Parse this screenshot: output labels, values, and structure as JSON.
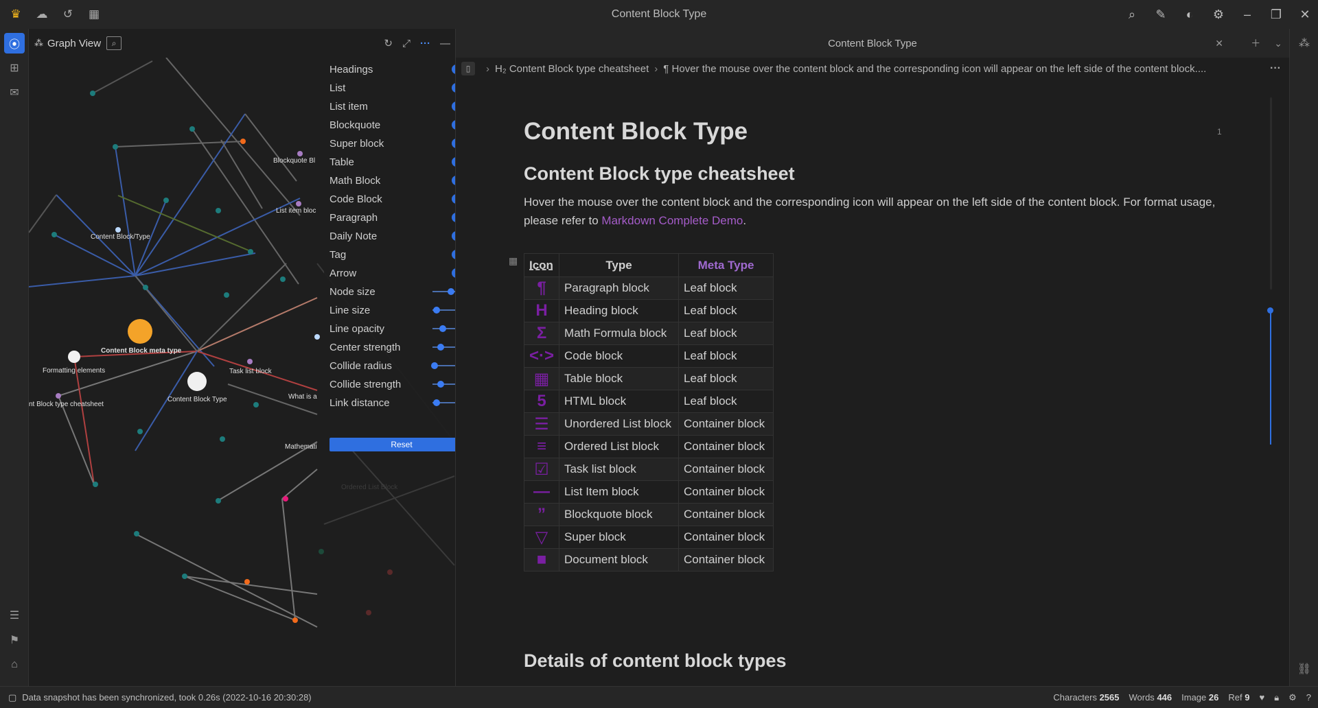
{
  "titlebar": {
    "title": "Content Block Type"
  },
  "graph": {
    "title": "Graph View",
    "toggles": [
      {
        "label": "Headings"
      },
      {
        "label": "List"
      },
      {
        "label": "List item"
      },
      {
        "label": "Blockquote"
      },
      {
        "label": "Super block"
      },
      {
        "label": "Table"
      },
      {
        "label": "Math Block"
      },
      {
        "label": "Code Block"
      },
      {
        "label": "Paragraph"
      },
      {
        "label": "Daily Note"
      },
      {
        "label": "Tag"
      },
      {
        "label": "Arrow"
      }
    ],
    "sliders": [
      {
        "label": "Node size",
        "value": 0.45
      },
      {
        "label": "Line size",
        "value": 0.1
      },
      {
        "label": "Line opacity",
        "value": 0.25
      },
      {
        "label": "Center strength",
        "value": 0.2
      },
      {
        "label": "Collide radius",
        "value": 0.05
      },
      {
        "label": "Collide strength",
        "value": 0.2
      },
      {
        "label": "Link distance",
        "value": 0.1
      }
    ],
    "reset_label": "Reset",
    "node_labels": {
      "blockquote": "Blockquote Bl",
      "list_item": "List item bloc",
      "content_block_type_path": "Content Block/Type",
      "meta_type": "Content Block meta type",
      "formatting": "Formatting elements",
      "cheatsheet": "nt Block type cheatsheet",
      "content_block_type": "Content Block Type",
      "task_list": "Task list block",
      "what_is": "What is a",
      "math": "Mathemati",
      "ordered": "Ordered List Block"
    }
  },
  "editor": {
    "tab_title": "Content Block Type",
    "breadcrumb": {
      "heading": "H₂ Content Block type cheatsheet",
      "paragraph": "¶ Hover the mouse over the content block and the corresponding icon will appear on the left side of the content block...."
    },
    "h1": "Content Block Type",
    "ref_count": "1",
    "h2": "Content Block type cheatsheet",
    "paragraph_start": "Hover the mouse over the content block and the corresponding icon will appear on the left side of the content block. For format usage, please refer to ",
    "paragraph_link": "Markdown Complete Demo",
    "paragraph_end": ".",
    "table": {
      "headers": [
        "Icon",
        "Type",
        "Meta Type"
      ],
      "rows": [
        {
          "icon": "¶",
          "icon_name": "paragraph-icon",
          "type": "Paragraph block",
          "meta": "Leaf block"
        },
        {
          "icon": "H",
          "icon_name": "heading-icon",
          "type": "Heading block",
          "meta": "Leaf block"
        },
        {
          "icon": "Σ",
          "icon_name": "math-icon",
          "type": "Math Formula block",
          "meta": "Leaf block"
        },
        {
          "icon": "<·>",
          "icon_name": "code-icon",
          "type": "Code block",
          "meta": "Leaf block"
        },
        {
          "icon": "▦",
          "icon_name": "table-icon",
          "type": "Table block",
          "meta": "Leaf block"
        },
        {
          "icon": "5",
          "icon_name": "html-icon",
          "type": "HTML block",
          "meta": "Leaf block"
        },
        {
          "icon": "☰",
          "icon_name": "unordered-list-icon",
          "type": "Unordered List block",
          "meta": "Container block"
        },
        {
          "icon": "≡",
          "icon_name": "ordered-list-icon",
          "type": "Ordered List block",
          "meta": "Container block"
        },
        {
          "icon": "☑",
          "icon_name": "task-list-icon",
          "type": "Task list block",
          "meta": "Container block"
        },
        {
          "icon": "—",
          "icon_name": "list-item-icon",
          "type": "List Item block",
          "meta": "Container block"
        },
        {
          "icon": "”",
          "icon_name": "blockquote-icon",
          "type": "Blockquote block",
          "meta": "Container block"
        },
        {
          "icon": "▽",
          "icon_name": "super-block-icon",
          "type": "Super block",
          "meta": "Container block"
        },
        {
          "icon": "■",
          "icon_name": "document-icon",
          "type": "Document block",
          "meta": "Container block"
        }
      ]
    },
    "h2b": "Details of content block types"
  },
  "status": {
    "message": "Data snapshot has been synchronized, took 0.26s (2022-10-16 20:30:28)",
    "characters_label": "Characters",
    "characters": "2565",
    "words_label": "Words",
    "words": "446",
    "image_label": "Image",
    "image": "26",
    "ref_label": "Ref",
    "ref": "9"
  },
  "colors": {
    "accent": "#2f6fe0",
    "icon_purple": "#7a1fa2",
    "link": "#a55cc9",
    "node_orange": "#f0a030"
  }
}
